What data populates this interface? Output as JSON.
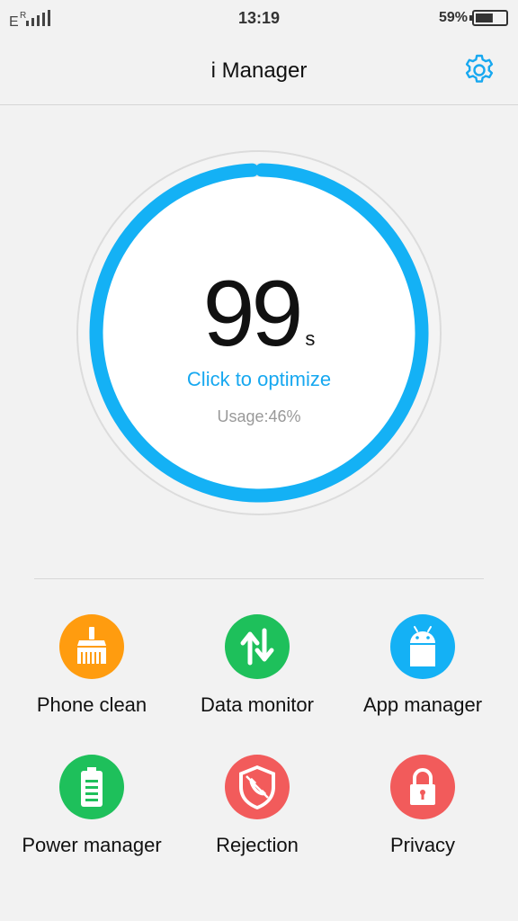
{
  "status_bar": {
    "network": "E",
    "roaming": "R",
    "time": "13:19",
    "battery": "59%"
  },
  "header": {
    "title": "i Manager",
    "settings_icon": "gear-icon"
  },
  "gauge": {
    "score": "99",
    "unit": "s",
    "action": "Click to optimize",
    "usage": "Usage:46%",
    "progress": 0.99
  },
  "tools": [
    {
      "label": "Phone clean",
      "icon": "broom-icon",
      "color": "#ff9c0f"
    },
    {
      "label": "Data monitor",
      "icon": "data-arrows-icon",
      "color": "#1ec05b"
    },
    {
      "label": "App manager",
      "icon": "android-icon",
      "color": "#14b1f5"
    },
    {
      "label": "Power manager",
      "icon": "battery-icon",
      "color": "#1ec05b"
    },
    {
      "label": "Rejection",
      "icon": "shield-phone-icon",
      "color": "#f25b5b"
    },
    {
      "label": "Privacy",
      "icon": "lock-icon",
      "color": "#f25b5b"
    }
  ],
  "colors": {
    "accent": "#17a8f0",
    "background": "#f2f2f2"
  }
}
